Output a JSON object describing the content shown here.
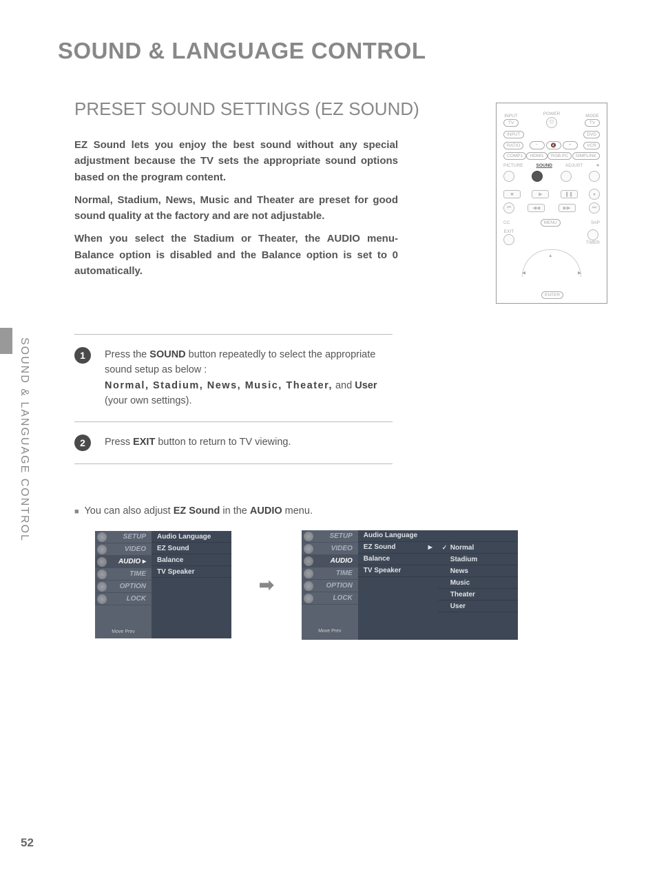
{
  "page_number": "52",
  "title": "SOUND & LANGUAGE CONTROL",
  "section": "PRESET SOUND SETTINGS (EZ SOUND)",
  "sidebar_label": "SOUND & LANGUAGE CONTROL",
  "paragraphs": {
    "p1": "EZ Sound lets you enjoy the best sound without any special adjustment because the TV sets the appropriate sound options based on the program content.",
    "p2": "Normal, Stadium, News, Music and Theater are preset for good sound quality at the factory and are not adjustable.",
    "p3": "When you select the Stadium or Theater, the AUDIO menu-Balance option is disabled and the Balance option is set to 0 automatically."
  },
  "steps": {
    "s1_a": "Press the ",
    "s1_b": "SOUND",
    "s1_c": " button repeatedly to select the appropriate sound setup as below :",
    "s1_presets": "Normal, Stadium, News, Music, Theater,",
    "s1_and": " and ",
    "s1_user": "User",
    "s1_tail": " (your own settings).",
    "s2_a": "Press ",
    "s2_b": "EXIT",
    "s2_c": " button to return to TV viewing."
  },
  "note": {
    "lead": "You can also adjust ",
    "ez": "EZ Sound",
    "mid": " in the ",
    "audio": "AUDIO",
    "tail": " menu."
  },
  "menu": {
    "tabs": [
      "SETUP",
      "VIDEO",
      "AUDIO",
      "TIME",
      "OPTION",
      "LOCK"
    ],
    "footer": "Move         Prev",
    "panel_items": [
      "Audio Language",
      "EZ Sound",
      "Balance",
      "TV Speaker"
    ],
    "submenu": [
      "Normal",
      "Stadium",
      "News",
      "Music",
      "Theater",
      "User"
    ]
  },
  "remote": {
    "input": "INPUT",
    "mode": "MODE",
    "tv": "TV",
    "dvd": "DVD",
    "vcr": "VCR",
    "power": "POWER",
    "ratio": "RATIO",
    "comp1": "COMP1",
    "hdmi1": "HDMI1",
    "rgbpc": "RGB-PC",
    "simplink": "SIMPLINK",
    "picture": "PICTURE",
    "sound": "SOUND",
    "adjust": "ADJUST",
    "cc": "CC",
    "exit": "EXIT",
    "menu": "MENU",
    "sap": "SAP",
    "timer": "TIMER",
    "enter": "ENTER"
  }
}
